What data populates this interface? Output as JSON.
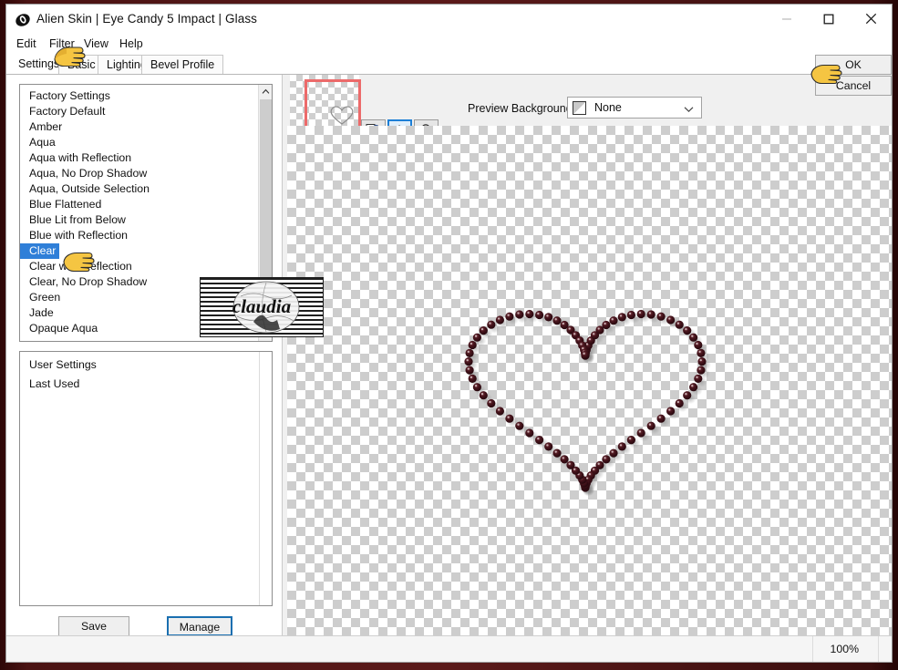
{
  "window": {
    "title": "Alien Skin | Eye Candy 5 Impact | Glass",
    "app_icon": "alien-skin-icon",
    "controls": {
      "minimize": "—",
      "maximize": "□",
      "close": "✕"
    }
  },
  "menubar": {
    "items": [
      {
        "label": "Edit"
      },
      {
        "label": "Filter"
      },
      {
        "label": "View"
      },
      {
        "label": "Help"
      }
    ]
  },
  "tabs": [
    {
      "label": "Settings",
      "active": true
    },
    {
      "label": "Basic",
      "active": false
    },
    {
      "label": "Lighting",
      "active": false
    },
    {
      "label": "Bevel Profile",
      "active": false
    }
  ],
  "settings_panel": {
    "factory_group_label": "Factory Settings",
    "factory_presets": [
      "Factory Default",
      "Amber",
      "Aqua",
      "Aqua with Reflection",
      "Aqua, No Drop Shadow",
      "Aqua, Outside Selection",
      "Blue Flattened",
      "Blue Lit from Below",
      "Blue with Reflection",
      "Clear",
      "Clear with Reflection",
      "Clear, No Drop Shadow",
      "Green",
      "Jade",
      "Opaque Aqua"
    ],
    "selected_preset": "Clear",
    "user_group_label": "User Settings",
    "user_presets": [
      "Last Used"
    ],
    "save_label": "Save",
    "manage_label": "Manage"
  },
  "preview": {
    "navigator_label": "navigator-thumbnail",
    "tools": [
      {
        "name": "preview-toggle-icon",
        "active": false
      },
      {
        "name": "hand-pan-icon",
        "active": true
      },
      {
        "name": "zoom-magnifier-icon",
        "active": false
      }
    ],
    "background_label": "Preview Background:",
    "background_value": "None",
    "background_options": [
      "None"
    ]
  },
  "dialog_buttons": {
    "ok_label": "OK",
    "cancel_label": "Cancel"
  },
  "statusbar": {
    "zoom_level": "100%"
  },
  "watermark": {
    "text": "claudia"
  },
  "colors": {
    "selection_blue": "#2f7fd8",
    "focus_blue": "#1a6fb0",
    "nav_rect_red": "#ec6a6a",
    "frame_maroon": "#4a1313",
    "bead_dark": "#3b0f17"
  },
  "annotations": {
    "cursors": [
      "pointing-hand-filter",
      "pointing-hand-clear",
      "pointing-hand-ok"
    ]
  }
}
